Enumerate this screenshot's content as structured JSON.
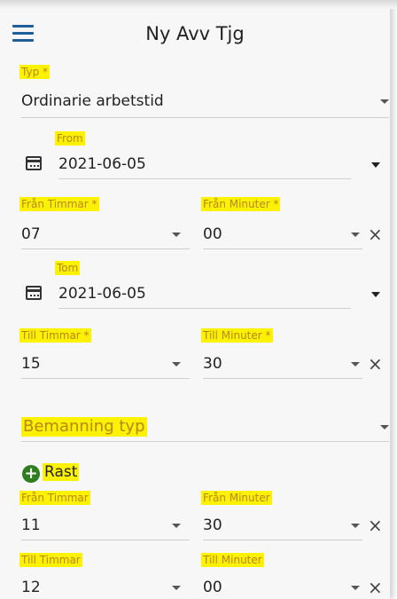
{
  "header": {
    "title": "Ny Avv Tjg",
    "menu_icon": "hamburger-menu-icon"
  },
  "typ": {
    "label": "Typ *",
    "value": "Ordinarie arbetstid"
  },
  "from": {
    "label": "From",
    "value": "2021-06-05",
    "icon": "calendar-icon"
  },
  "from_time": {
    "hour_label": "Från Timmar *",
    "hour_value": "07",
    "minute_label": "Från Minuter *",
    "minute_value": "00",
    "clear_icon": "×"
  },
  "tom": {
    "label": "Tom",
    "value": "2021-06-05",
    "icon": "calendar-icon"
  },
  "to_time": {
    "hour_label": "Till Timmar *",
    "hour_value": "15",
    "minute_label": "Till Minuter *",
    "minute_value": "30",
    "clear_icon": "×"
  },
  "bemanning": {
    "placeholder": "Bemanning typ"
  },
  "rast": {
    "add_icon": "+",
    "label": "Rast",
    "from_hour_label": "Från Timmar",
    "from_hour_value": "11",
    "from_minute_label": "Från Minuter",
    "from_minute_value": "30",
    "to_hour_label": "Till Timmar",
    "to_hour_value": "12",
    "to_minute_label": "Till Minuter",
    "to_minute_value": "00"
  },
  "colors": {
    "highlight": "#fff200",
    "accent": "#1e5f9a",
    "add_green": "#2e7d1e"
  }
}
